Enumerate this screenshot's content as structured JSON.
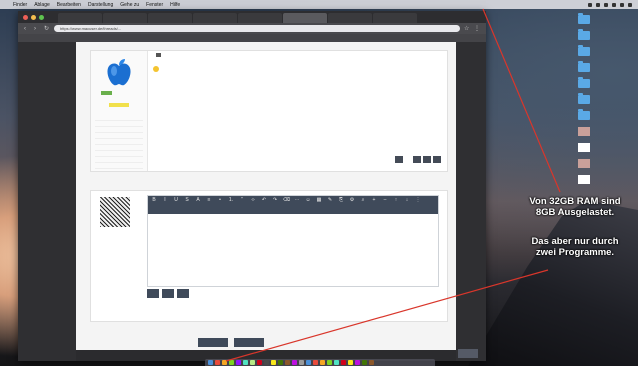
{
  "menubar": {
    "apple": "",
    "items": [
      "Finder",
      "Ablage",
      "Bearbeiten",
      "Darstellung",
      "Gehe zu",
      "Fenster",
      "Hilfe"
    ]
  },
  "browser": {
    "tabs": [
      "",
      "",
      "",
      "",
      "",
      "",
      "",
      "",
      "",
      ""
    ],
    "url": "https://www.macuser.de/threads/...",
    "bookmarks": [
      "",
      "",
      "",
      "",
      "",
      "",
      "",
      "",
      "",
      "",
      "",
      ""
    ]
  },
  "post1": {
    "username": "",
    "rank": "",
    "stats": [
      {
        "label": "",
        "value": ""
      },
      {
        "label": "",
        "value": ""
      },
      {
        "label": "",
        "value": ""
      },
      {
        "label": "",
        "value": ""
      },
      {
        "label": "",
        "value": ""
      },
      {
        "label": "",
        "value": ""
      },
      {
        "label": "",
        "value": ""
      },
      {
        "label": "",
        "value": ""
      },
      {
        "label": "",
        "value": ""
      }
    ],
    "time": "",
    "badge": "",
    "line1": "",
    "line2": ""
  },
  "reply": {
    "username": "",
    "line1": "",
    "line2": "",
    "line2_link": "",
    "line3": "",
    "line4": "",
    "buttons": [
      "",
      "",
      ""
    ],
    "submit": "",
    "preview": ""
  },
  "footer": {
    "text": "",
    "top_button": ""
  },
  "desktop_icons": [
    {
      "type": "folder",
      "label": ""
    },
    {
      "type": "folder",
      "label": ""
    },
    {
      "type": "folder",
      "label": ""
    },
    {
      "type": "folder",
      "label": ""
    },
    {
      "type": "folder",
      "label": ""
    },
    {
      "type": "folder",
      "label": ""
    },
    {
      "type": "folder",
      "label": ""
    },
    {
      "type": "image",
      "label": ""
    },
    {
      "type": "file",
      "label": ""
    },
    {
      "type": "image",
      "label": ""
    },
    {
      "type": "file",
      "label": ""
    }
  ],
  "annotations": {
    "ram_line1": "Von 32GB RAM sind",
    "ram_line2": "8GB  Ausgelastet.",
    "prog_line1": "Das aber nur durch",
    "prog_line2": "zwei Programme."
  },
  "colors": {
    "annotation_line": "#d9362b",
    "folder": "#5aa9e6",
    "toolbar": "#3f4a5a"
  }
}
